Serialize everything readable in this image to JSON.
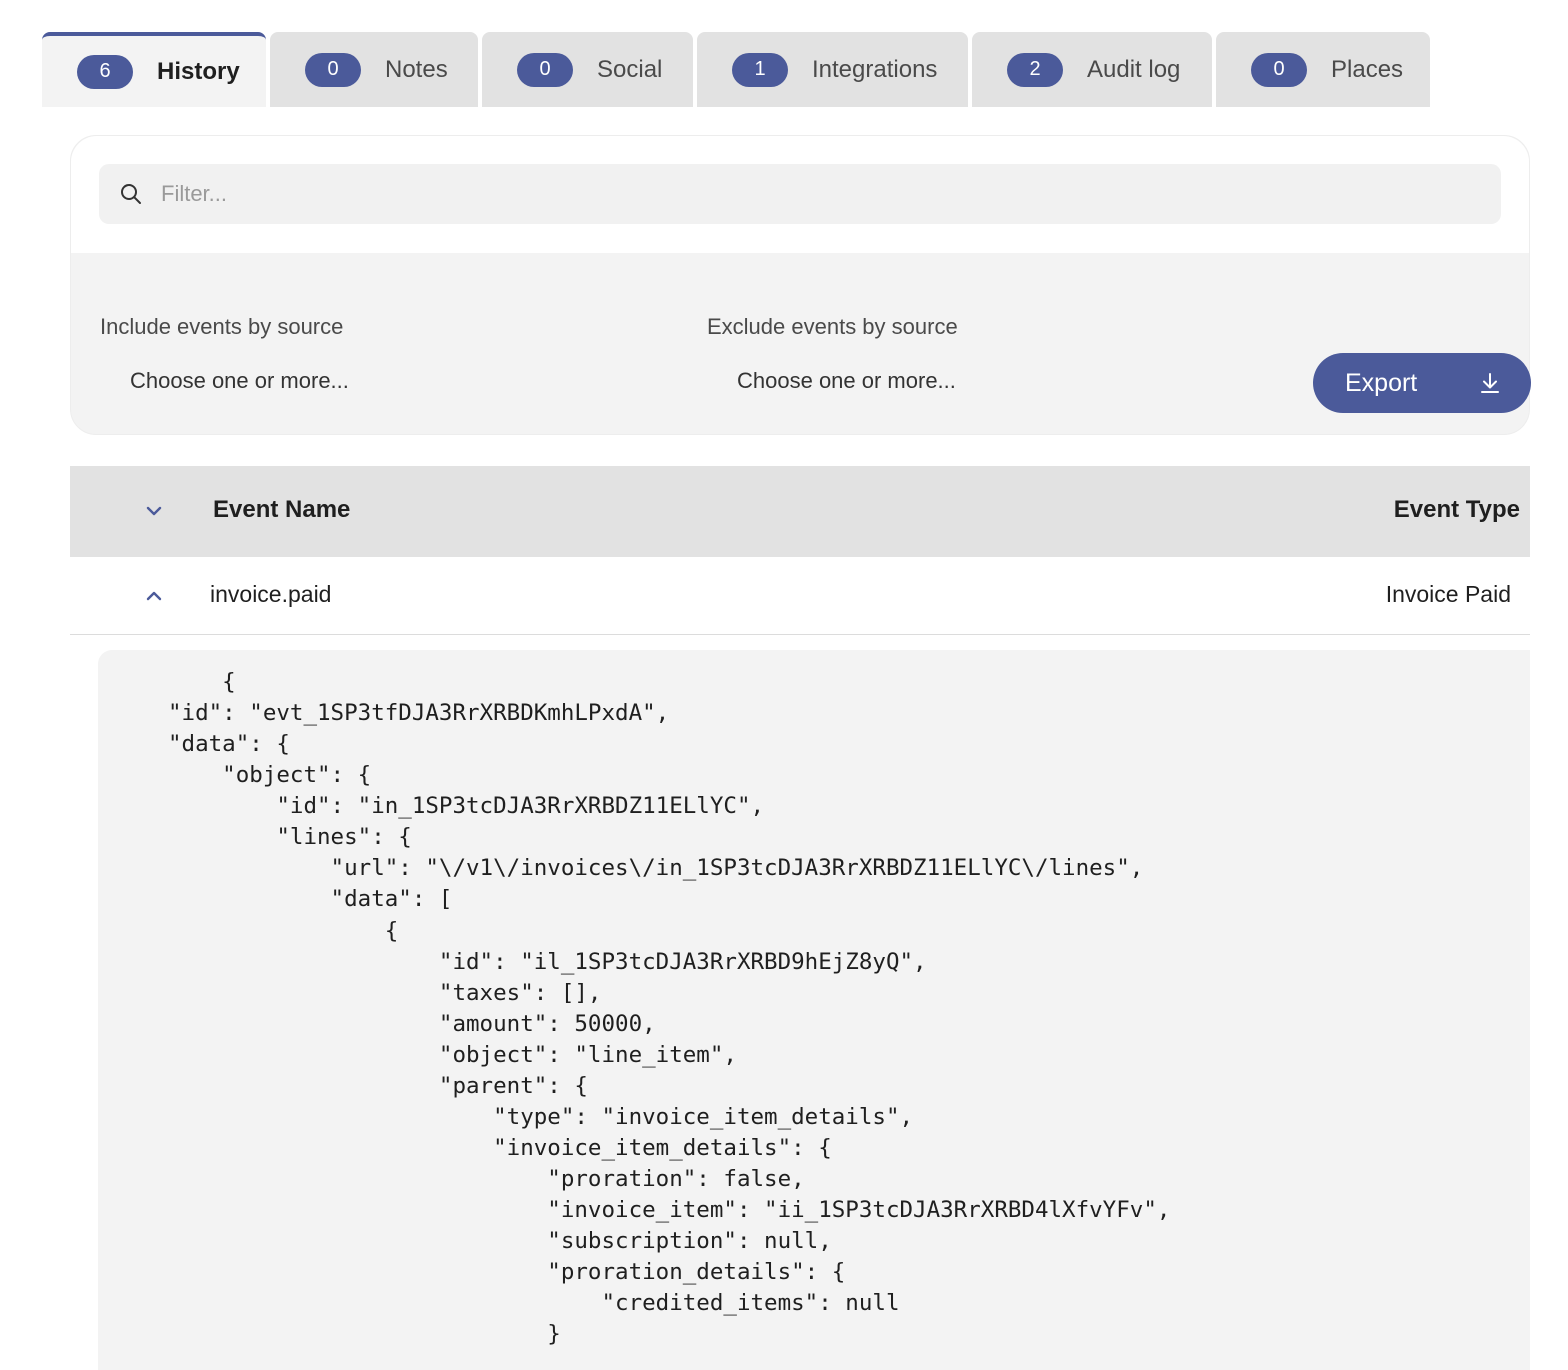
{
  "tabs": [
    {
      "count": "6",
      "label": "History",
      "active": true
    },
    {
      "count": "0",
      "label": "Notes"
    },
    {
      "count": "0",
      "label": "Social"
    },
    {
      "count": "1",
      "label": "Integrations"
    },
    {
      "count": "2",
      "label": "Audit log"
    },
    {
      "count": "0",
      "label": "Places"
    }
  ],
  "filter": {
    "placeholder": "Filter...",
    "include_label": "Include events by source",
    "include_placeholder": "Choose one or more...",
    "exclude_label": "Exclude events by source",
    "exclude_placeholder": "Choose one or more...",
    "export_label": "Export"
  },
  "table": {
    "headers": {
      "name": "Event Name",
      "type": "Event Type"
    },
    "rows": [
      {
        "name": "invoice.paid",
        "type": "Invoice Paid"
      }
    ]
  },
  "payload": "    {\n\"id\": \"evt_1SP3tfDJA3RrXRBDKmhLPxdA\",\n\"data\": {\n    \"object\": {\n        \"id\": \"in_1SP3tcDJA3RrXRBDZ11ELlYC\",\n        \"lines\": {\n            \"url\": \"\\/v1\\/invoices\\/in_1SP3tcDJA3RrXRBDZ11ELlYC\\/lines\",\n            \"data\": [\n                {\n                    \"id\": \"il_1SP3tcDJA3RrXRBD9hEjZ8yQ\",\n                    \"taxes\": [],\n                    \"amount\": 50000,\n                    \"object\": \"line_item\",\n                    \"parent\": {\n                        \"type\": \"invoice_item_details\",\n                        \"invoice_item_details\": {\n                            \"proration\": false,\n                            \"invoice_item\": \"ii_1SP3tcDJA3RrXRBD4lXfvYFv\",\n                            \"subscription\": null,\n                            \"proration_details\": {\n                                \"credited_items\": null\n                            }",
  "colors": {
    "accent": "#4b5a9a",
    "tab_bg": "#e2e2e2",
    "panel_bg": "#f3f3f3"
  }
}
